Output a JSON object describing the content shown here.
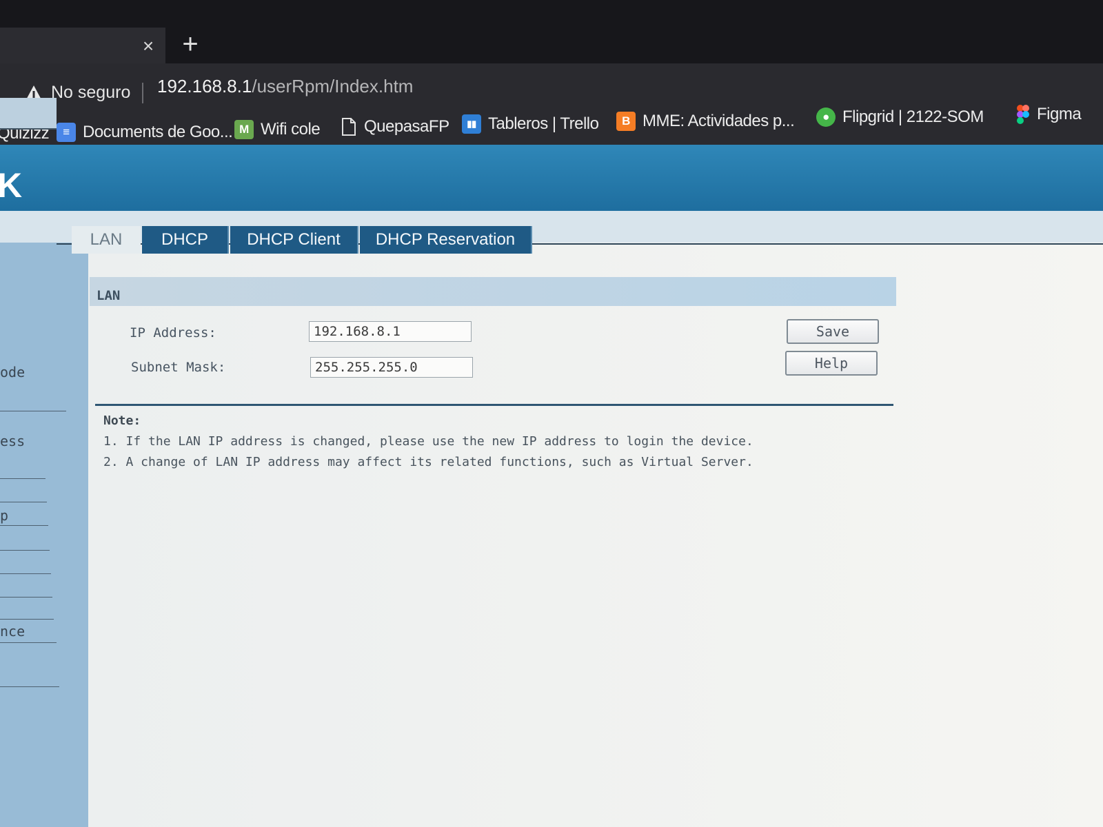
{
  "browser": {
    "tab_close_glyph": "×",
    "new_tab_glyph": "+",
    "security_label": "No seguro",
    "url_host": "192.168.8.1",
    "url_path": "/userRpm/Index.htm",
    "bookmarks": [
      {
        "label": "Quizizz",
        "icon": "none"
      },
      {
        "label": "Documents de Goo...",
        "icon": "google-docs-icon",
        "icon_color": "#4a86e8",
        "glyph": "≡"
      },
      {
        "label": "Wifi cole",
        "icon": "m-badge-icon",
        "icon_color": "#6aa84f",
        "glyph": "M"
      },
      {
        "label": "QuepasaFP",
        "icon": "page-icon"
      },
      {
        "label": "Tableros | Trello",
        "icon": "trello-icon",
        "icon_color": "#2f7fd6",
        "glyph": "▮▮"
      },
      {
        "label": "MME: Actividades p...",
        "icon": "blogger-icon",
        "icon_color": "#f57d25",
        "glyph": "B"
      },
      {
        "label": "Flipgrid | 2122-SOM",
        "icon": "flipgrid-icon",
        "icon_color": "#45b649",
        "glyph": "●"
      },
      {
        "label": "Figma",
        "icon": "figma-icon",
        "icon_color": "#f24e1e"
      }
    ]
  },
  "router": {
    "tabs": [
      "LAN",
      "DHCP",
      "DHCP Client",
      "DHCP Reservation"
    ],
    "active_tab": "LAN",
    "sidebar_fragments": [
      "ode",
      "ess",
      "p",
      "nce"
    ],
    "section_title": "LAN",
    "fields": {
      "ip_label": "IP Address:",
      "ip_value": "192.168.8.1",
      "mask_label": "Subnet Mask:",
      "mask_value": "255.255.255.0"
    },
    "buttons": {
      "save": "Save",
      "help": "Help"
    },
    "note": {
      "title": "Note:",
      "lines": [
        "1. If the LAN IP address is changed, please use the new IP address to login the device.",
        "2. A change of LAN IP address may affect its related functions, such as Virtual Server."
      ]
    }
  },
  "colors": {
    "header_blue": "#2f87b8",
    "tab_blue": "#1f5a85",
    "section_blue": "#b9d3e6"
  }
}
